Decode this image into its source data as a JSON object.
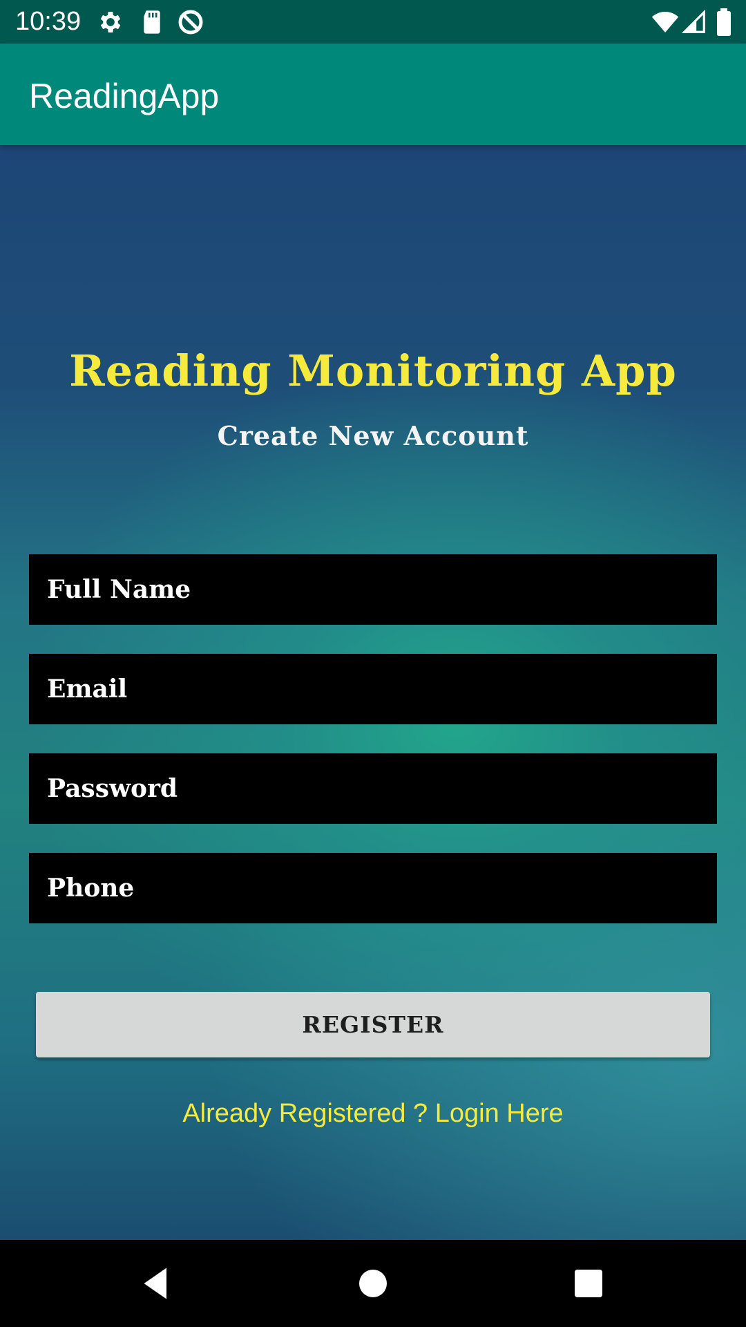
{
  "status_bar": {
    "time": "10:39",
    "left_icons": [
      "settings-gear-icon",
      "sd-card-icon",
      "data-saver-icon"
    ],
    "right_icons": [
      "wifi-icon",
      "cell-signal-icon",
      "battery-icon"
    ]
  },
  "app_bar": {
    "title": "ReadingApp",
    "color": "#00897b"
  },
  "main": {
    "headline": "Reading Monitoring App",
    "subheadline": "Create New Account",
    "fields": {
      "full_name": {
        "placeholder": "Full Name",
        "value": ""
      },
      "email": {
        "placeholder": "Email",
        "value": ""
      },
      "password": {
        "placeholder": "Password",
        "value": ""
      },
      "phone": {
        "placeholder": "Phone",
        "value": ""
      }
    },
    "register_label": "REGISTER",
    "login_link": "Already Registered ? Login Here"
  },
  "nav_bar": {
    "buttons": [
      "back-triangle-icon",
      "home-circle-icon",
      "recents-square-icon"
    ]
  },
  "colors": {
    "accent_yellow": "#f6ea3d",
    "status_bar": "#00584f",
    "button_bg": "#d6d7d7"
  }
}
